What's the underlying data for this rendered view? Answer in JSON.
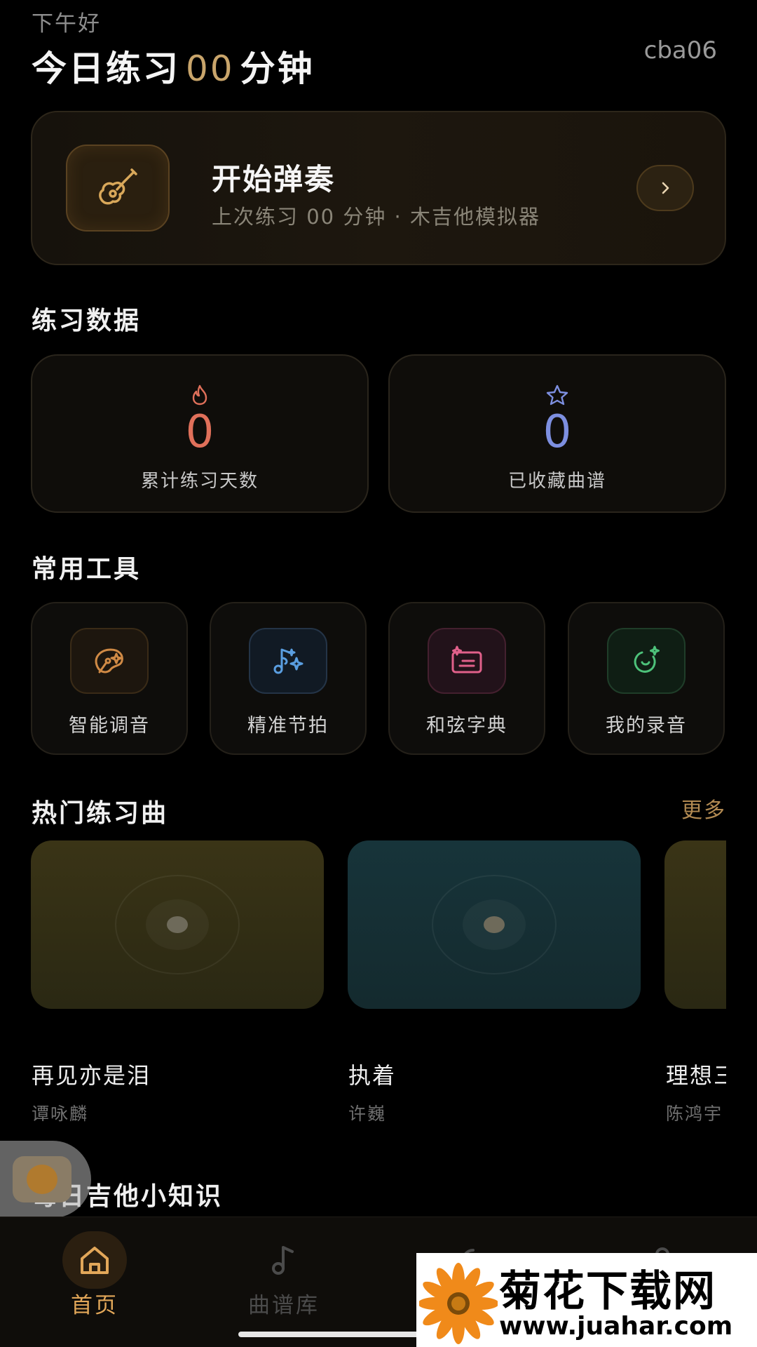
{
  "header": {
    "greeting": "下午好",
    "today_prefix": "今日练习",
    "today_minutes": "00",
    "today_suffix": "分钟",
    "username": "cba06"
  },
  "start_card": {
    "title": "开始弹奏",
    "subtitle": "上次练习 00 分钟 · 木吉他模拟器",
    "icon": "guitar-icon",
    "arrow_icon": "chevron-right-icon"
  },
  "practice_data": {
    "section_title": "练习数据",
    "stats": [
      {
        "icon": "flame-icon",
        "value": "0",
        "label": "累计练习天数",
        "color": "#e0705a"
      },
      {
        "icon": "star-icon",
        "value": "0",
        "label": "已收藏曲谱",
        "color": "#7d8fe0"
      }
    ]
  },
  "tools": {
    "section_title": "常用工具",
    "items": [
      {
        "label": "智能调音",
        "icon": "tuner-icon",
        "color": "#d08a45"
      },
      {
        "label": "精准节拍",
        "icon": "metronome-icon",
        "color": "#5a9ee0"
      },
      {
        "label": "和弦字典",
        "icon": "chord-dictionary-icon",
        "color": "#e0608a"
      },
      {
        "label": "我的录音",
        "icon": "recording-icon",
        "color": "#4dc27a"
      }
    ]
  },
  "popular": {
    "section_title": "热门练习曲",
    "more_label": "更多",
    "songs": [
      {
        "title": "再见亦是泪",
        "artist": "谭咏麟"
      },
      {
        "title": "执着",
        "artist": "许巍"
      },
      {
        "title": "理想三",
        "artist": "陈鸿宇"
      }
    ]
  },
  "tips": {
    "section_title": "每日吉他小知识"
  },
  "tabbar": {
    "tabs": [
      {
        "label": "首页",
        "icon": "home-icon",
        "active": true
      },
      {
        "label": "曲谱库",
        "icon": "music-note-icon",
        "active": false
      },
      {
        "label": "",
        "icon": "progress-icon",
        "active": false
      },
      {
        "label": "",
        "icon": "profile-icon",
        "active": false
      }
    ]
  },
  "watermark": {
    "title": "菊花下载网",
    "url": "www.juahar.com"
  }
}
